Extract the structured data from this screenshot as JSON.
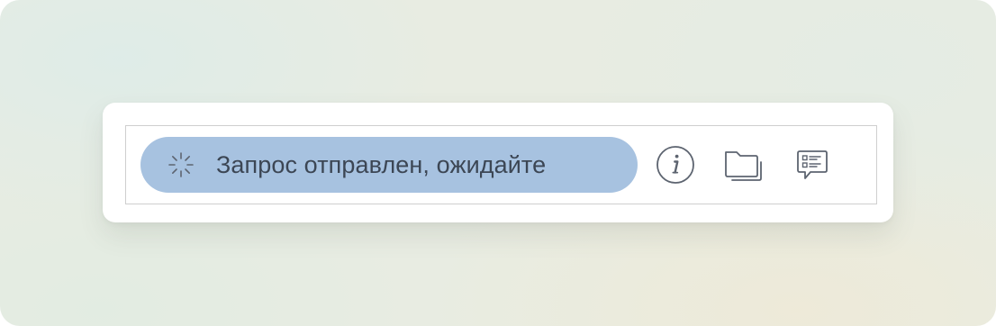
{
  "status": {
    "text": "Запрос отправлен, ожидайте",
    "icon": "loading-spinner-icon",
    "pill_color": "#a7c2e0",
    "text_color": "#3c4654"
  },
  "actions": [
    {
      "name": "info-button",
      "icon": "info-icon"
    },
    {
      "name": "folder-button",
      "icon": "folders-icon"
    },
    {
      "name": "chat-button",
      "icon": "chat-list-icon"
    }
  ],
  "colors": {
    "icon_stroke": "#5d6470",
    "card_background": "#ffffff",
    "toolbar_border": "#cfcfcf"
  }
}
